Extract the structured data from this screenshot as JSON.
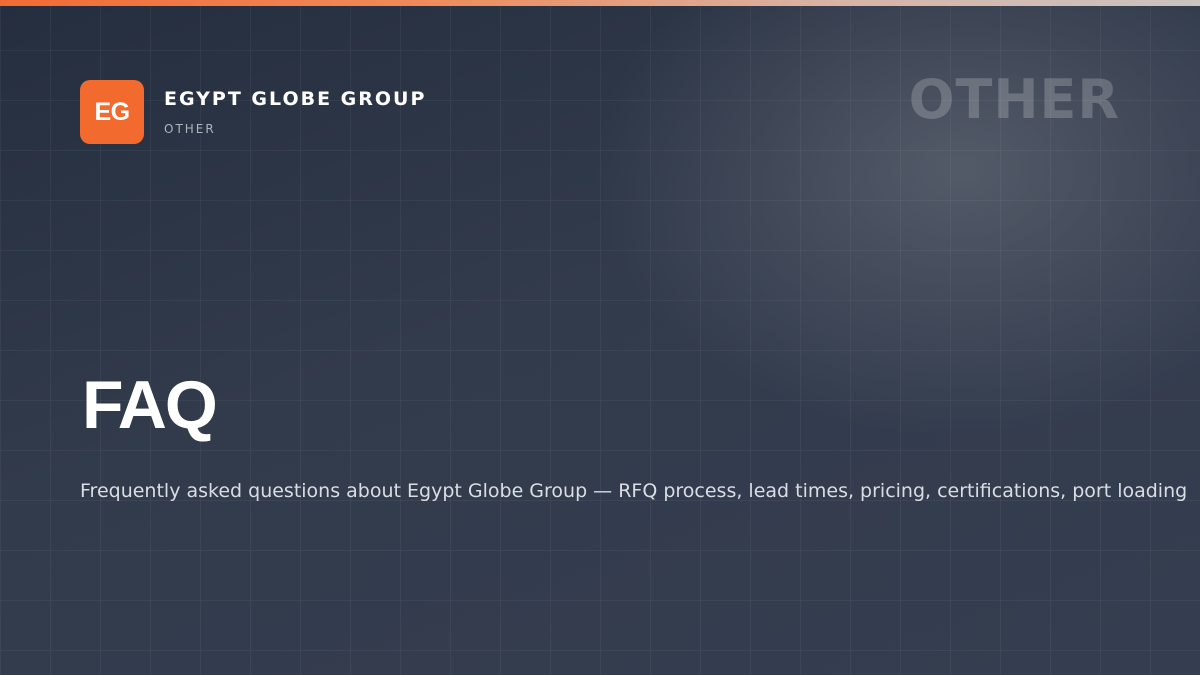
{
  "brand": {
    "logo_text": "EG",
    "name": "EGYPT GLOBE GROUP",
    "category": "OTHER"
  },
  "watermark": "OTHER",
  "page": {
    "title": "FAQ",
    "description": "Frequently asked questions about Egypt Globe Group — RFQ process, lead times, pricing, certifications, port loading"
  },
  "colors": {
    "accent": "#f26a2e",
    "background": "#323b4c",
    "text": "#ffffff"
  }
}
